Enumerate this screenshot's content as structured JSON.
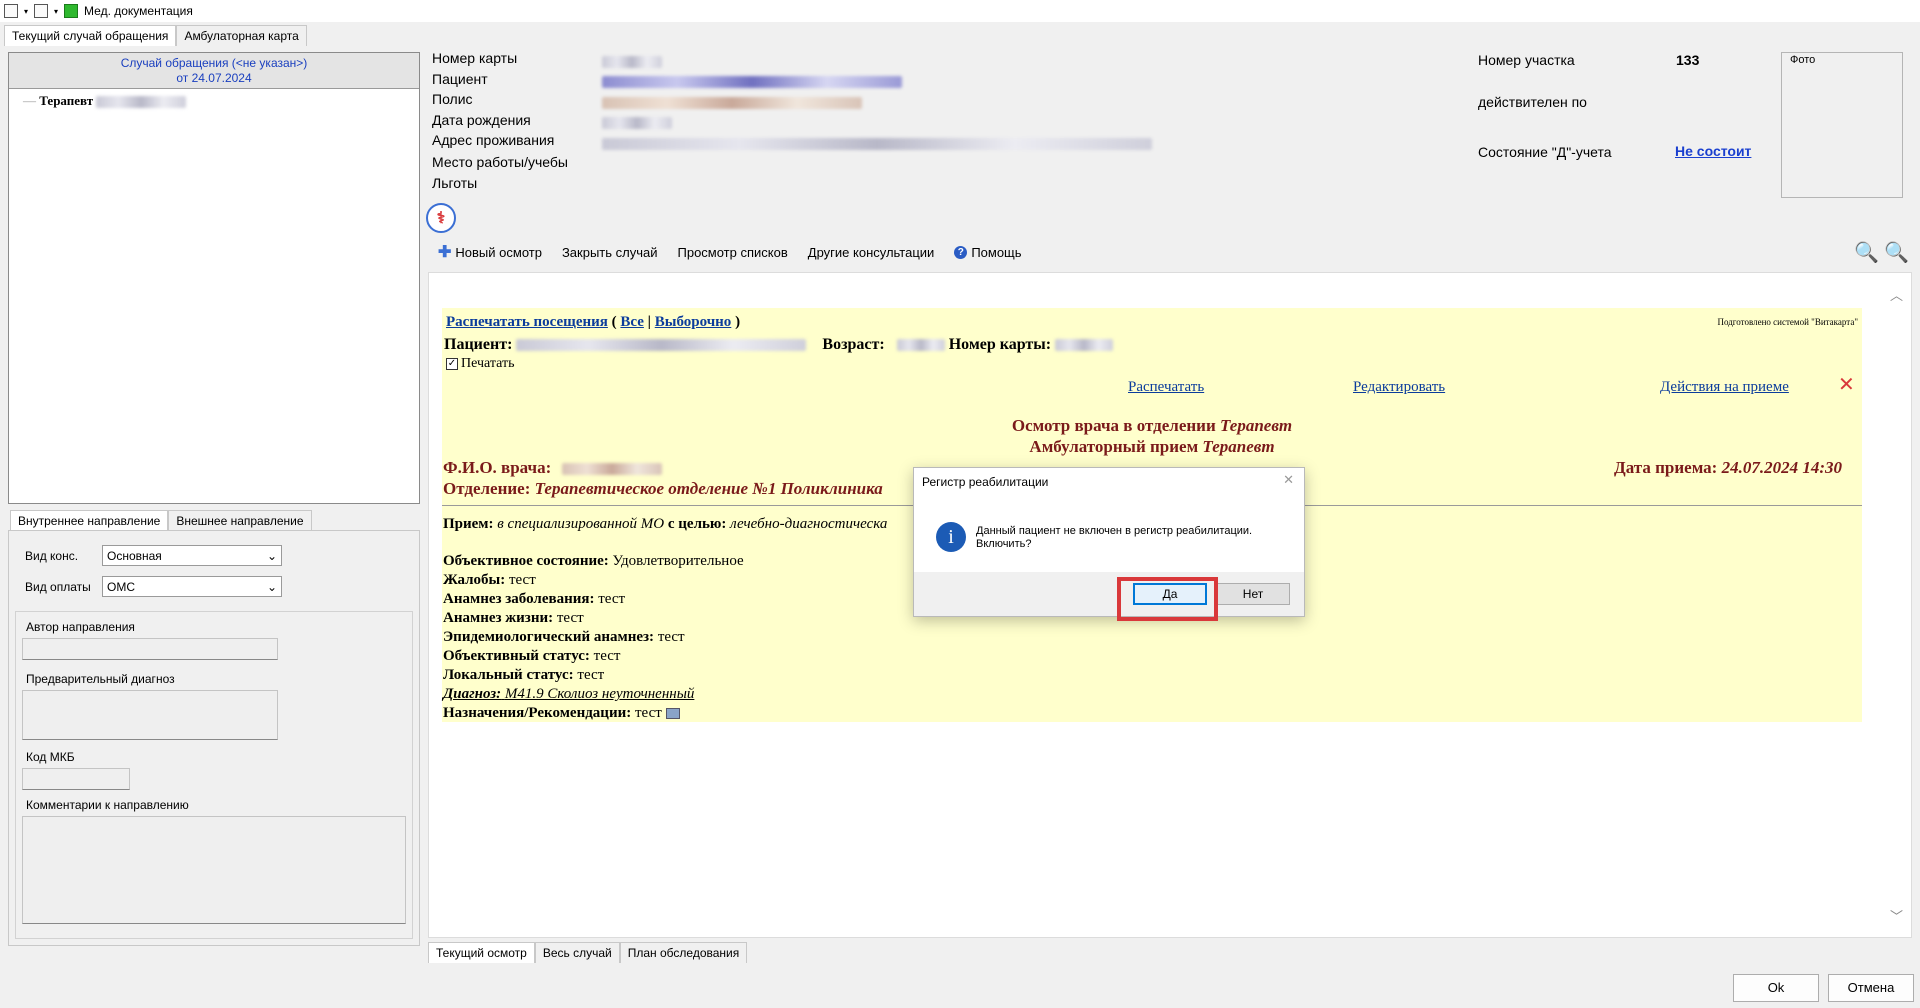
{
  "window": {
    "title": "Мед. документация"
  },
  "top_tabs": [
    "Текущий случай обращения",
    "Амбулаторная карта"
  ],
  "case": {
    "header_line1": "Случай обращения (<не указан>)",
    "header_line2": "от 24.07.2024",
    "tree_node": "Терапевт"
  },
  "direction_tabs": [
    "Внутреннее направление",
    "Внешнее направление"
  ],
  "direction": {
    "kind_label": "Вид конс.",
    "kind_value": "Основная",
    "payment_label": "Вид оплаты",
    "payment_value": "ОМС",
    "author_label": "Автор направления",
    "prelim_diag_label": "Предварительный диагноз",
    "mkb_label": "Код МКБ",
    "comments_label": "Комментарии к направлению"
  },
  "patient_info": {
    "labels": [
      "Номер карты",
      "Пациент",
      "Полис",
      "Дата рождения",
      "Адрес проживания",
      "Место работы/учебы",
      "Льготы"
    ],
    "district_label": "Номер участка",
    "district_value": "133",
    "valid_until_label": "действителен по",
    "d_status_label": "Состояние \"Д\"-учета",
    "d_status_value": "Не состоит",
    "photo_label": "Фото"
  },
  "toolbar": {
    "new_exam": "Новый осмотр",
    "close_case": "Закрыть случай",
    "view_lists": "Просмотр списков",
    "other_consult": "Другие консультации",
    "help": "Помощь"
  },
  "document": {
    "print_visits": "Распечатать посещения",
    "all": "Все",
    "selective": "Выборочно",
    "open_paren": "(",
    "separator": "|",
    "close_paren": ")",
    "prepared_by": "Подготовлено системой \"Витакарта\"",
    "patient_label": "Пациент:",
    "age_label": "Возраст:",
    "card_label": "Номер карты:",
    "print_checkbox": "Печатать",
    "action_print": "Распечатать",
    "action_edit": "Редактировать",
    "action_actions": "Действия на приеме",
    "heading1_prefix": "Осмотр врача в отделении ",
    "heading1_value": "Терапевт",
    "heading2_prefix": "Амбулаторный прием ",
    "heading2_value": "Терапевт",
    "doctor_label": "Ф.И.О. врача:",
    "date_label": "Дата приема:",
    "date_value": "24.07.2024 14:30",
    "dept_label": "Отделение:",
    "dept_value": "Терапевтическое отделение №1 Поликлиника",
    "reception_label": "Прием:",
    "reception_value": "в специализированной МО",
    "purpose_label": "с целью:",
    "purpose_value": "лечебно-диагностическа",
    "lines": [
      {
        "label": "Объективное состояние:",
        "value": "Удовлетворительное"
      },
      {
        "label": "Жалобы:",
        "value": "тест"
      },
      {
        "label": "Анамнез заболевания:",
        "value": "тест"
      },
      {
        "label": "Анамнез жизни:",
        "value": "тест"
      },
      {
        "label": "Эпидемиологический анамнез:",
        "value": "тест"
      },
      {
        "label": "Объективный статус:",
        "value": "тест"
      },
      {
        "label": "Локальный статус:",
        "value": "тест"
      }
    ],
    "diagnosis_label": "Диагноз:",
    "diagnosis_value": "M41.9 Сколиоз неуточненный",
    "recommend_label": "Назначения/Рекомендации:",
    "recommend_value": "тест"
  },
  "bottom_tabs": [
    "Текущий осмотр",
    "Весь случай",
    "План обследования"
  ],
  "dialog": {
    "title": "Регистр реабилитации",
    "message": "Данный пациент не включен в регистр реабилитации. Включить?",
    "yes": "Да",
    "no": "Нет"
  },
  "footer": {
    "ok": "Ok",
    "cancel": "Отмена"
  },
  "colors": {
    "accent_link": "#0b3c9c",
    "doc_bg": "#ffffcc",
    "highlight": "#d9383a",
    "dark_red": "#7a1a1a"
  }
}
